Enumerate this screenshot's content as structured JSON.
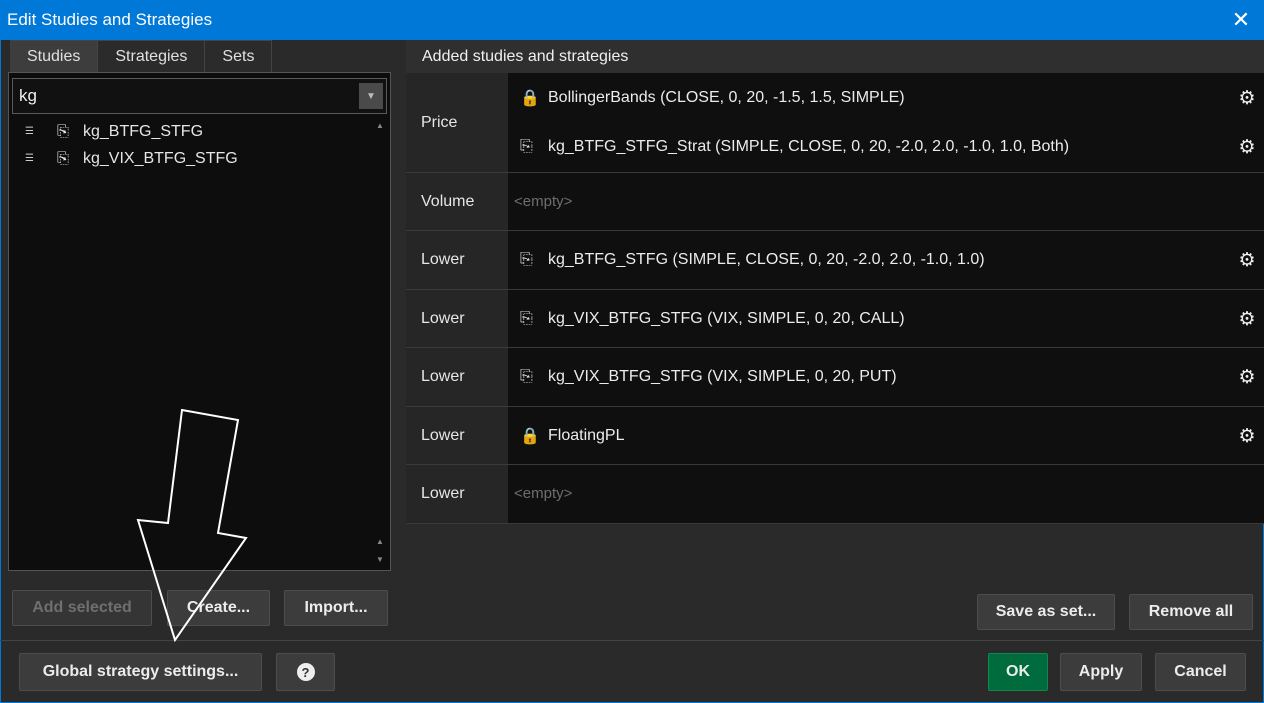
{
  "window": {
    "title": "Edit Studies and Strategies",
    "close_glyph": "✕"
  },
  "left": {
    "tabs": [
      "Studies",
      "Strategies",
      "Sets"
    ],
    "search_value": "kg",
    "items": [
      "kg_BTFG_STFG",
      "kg_VIX_BTFG_STFG"
    ],
    "buttons": {
      "add_selected": "Add selected",
      "create": "Create...",
      "import": "Import..."
    }
  },
  "right": {
    "header": "Added studies and strategies",
    "rows": [
      {
        "label": "Price",
        "entries": [
          {
            "text": "BollingerBands (CLOSE, 0, 20, -1.5, 1.5, SIMPLE)",
            "icon": "locked-script-icon"
          },
          {
            "text": "kg_BTFG_STFG_Strat (SIMPLE, CLOSE, 0, 20, -2.0, 2.0, -1.0, 1.0, Both)",
            "icon": "script-icon"
          }
        ]
      },
      {
        "label": "Volume",
        "empty": "<empty>"
      },
      {
        "label": "Lower",
        "entries": [
          {
            "text": "kg_BTFG_STFG (SIMPLE, CLOSE, 0, 20, -2.0, 2.0, -1.0, 1.0)",
            "icon": "script-icon"
          }
        ]
      },
      {
        "label": "Lower",
        "entries": [
          {
            "text": "kg_VIX_BTFG_STFG (VIX, SIMPLE, 0, 20, CALL)",
            "icon": "script-icon"
          }
        ]
      },
      {
        "label": "Lower",
        "entries": [
          {
            "text": "kg_VIX_BTFG_STFG (VIX, SIMPLE, 0, 20, PUT)",
            "icon": "script-icon"
          }
        ]
      },
      {
        "label": "Lower",
        "entries": [
          {
            "text": "FloatingPL",
            "icon": "locked-script-icon"
          }
        ]
      },
      {
        "label": "Lower",
        "empty": "<empty>"
      }
    ],
    "buttons": {
      "save_as_set": "Save as set...",
      "remove_all": "Remove all"
    }
  },
  "footer": {
    "global_settings": "Global strategy settings...",
    "help": "?",
    "ok": "OK",
    "apply": "Apply",
    "cancel": "Cancel"
  },
  "colors": {
    "titlebar": "#0078d7",
    "ok_button": "#006b3c",
    "background": "#2a2a2a"
  }
}
